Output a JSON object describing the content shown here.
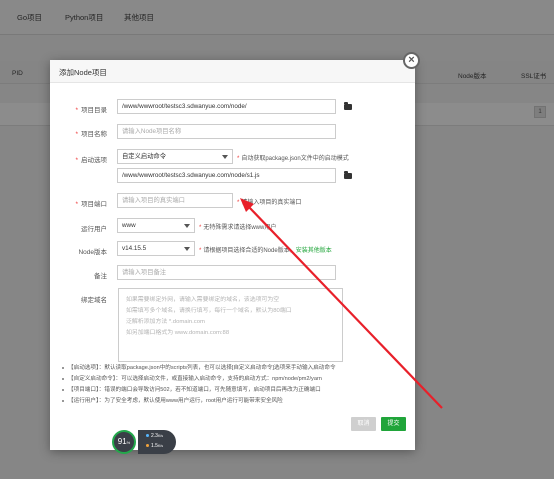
{
  "tabs": [
    "Go项目",
    "Python项目",
    "其他项目"
  ],
  "table": {
    "pid": "PID",
    "node_version": "Node版本",
    "ssl": "SSL证书",
    "row_btn": "1"
  },
  "modal": {
    "title": "添加Node项目",
    "close_icon": "close-icon",
    "project_dir": {
      "label": "项目目录",
      "value": "/www/wwwroot/testsc3.sdwanyue.com/node/"
    },
    "project_name": {
      "label": "项目名称",
      "placeholder": "请输入Node项目名称"
    },
    "start_option": {
      "label": "启动选项",
      "selected": "自定义启动命令",
      "hint": "自动获取package.json文件中的启动模式",
      "command": "/www/wwwroot/testsc3.sdwanyue.com/node/s1.js"
    },
    "port": {
      "label": "项目端口",
      "placeholder": "请输入项目的真实端口",
      "hint": "请输入项目的真实端口"
    },
    "run_user": {
      "label": "运行用户",
      "selected": "www",
      "hint": "无特殊需求请选择www用户"
    },
    "node_version": {
      "label": "Node版本",
      "selected": "v14.15.5",
      "hint": "请根据项目选择合适的Node版本，",
      "link": "安装其他版本"
    },
    "remark": {
      "label": "备注",
      "placeholder": "请输入项目备注"
    },
    "domain": {
      "label": "绑定域名",
      "lines": [
        "如果需要绑定外网，请输入需要绑定的域名，该选项可为空",
        "如需填写多个域名，请换行填写，每行一个域名，默认为80端口",
        "泛解析添加方法 *.domain.com",
        "如另加端口格式为 www.domain.com:88"
      ]
    },
    "tips": [
      "【启动选项】：默认读取package.json中的scripts列表，也可以选择[自定义启动命令]选项来手动输入启动命令",
      "【自定义启动命令】：可以选择启动文件，或直接输入启动命令，支持的启动方式：npm/node/pm2/yarn",
      "【项目端口】：错误的端口会导致访问502，若不知道端口，可先随意填写，启动项目后再改为正确端口",
      "【运行用户】：为了安全考虑，默认使用www用户运行，root用户运行可能带来安全风险"
    ],
    "cancel": "取消",
    "submit": "提交"
  },
  "monitor": {
    "percent": "91",
    "percent_unit": "%",
    "up": "2.3",
    "up_unit": "K/s",
    "down": "1.5",
    "down_unit": "K/s"
  },
  "colors": {
    "accent": "#20a53a",
    "annotation_arrow": "#e8202a"
  }
}
